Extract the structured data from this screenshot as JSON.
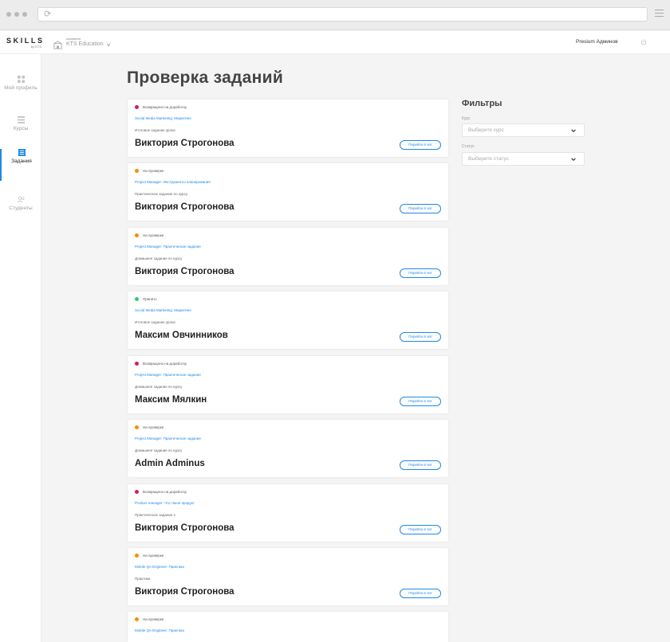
{
  "header": {
    "logo_main": "SKILLS",
    "logo_sub": "by KTS",
    "company_label": "компания",
    "company_name": "KTS Education",
    "user_name": "Presium Админов"
  },
  "sidebar": {
    "items": [
      {
        "label": "Мой профиль",
        "icon": "dashboard-icon",
        "active": false
      },
      {
        "label": "Курсы",
        "icon": "list-icon",
        "active": false
      },
      {
        "label": "Задания",
        "icon": "tasks-icon",
        "active": true
      },
      {
        "label": "Студенты",
        "icon": "users-icon",
        "active": false
      }
    ]
  },
  "page": {
    "title": "Проверка заданий",
    "chat_button_label": "Перейти в чат"
  },
  "colors": {
    "accent": "#1e88e5",
    "status_returned": "#d81b60",
    "status_review": "#fb8c00",
    "status_accepted": "#2ecc71"
  },
  "cards": [
    {
      "status": "Возвращено на доработку",
      "course": "Social Media Marketing: Маркетинг",
      "task": "Итоговое задание урока",
      "student": "Виктория Строгонова"
    },
    {
      "status": "На проверке",
      "course": "Project Manager: Инструменты планирования",
      "task": "Практическое задание по курсу",
      "student": "Виктория Строгонова"
    },
    {
      "status": "На проверке",
      "course": "Project Manager: Практическое задание",
      "task": "Домашнее задание по курсу",
      "student": "Виктория Строгонова"
    },
    {
      "status": "Принято",
      "course": "Social Media Marketing: Маркетинг",
      "task": "Итоговое задание урока",
      "student": "Максим Овчинников"
    },
    {
      "status": "Возвращено на доработку",
      "course": "Project Manager: Практическое задание",
      "task": "Домашнее задание по курсу",
      "student": "Максим Мялкин"
    },
    {
      "status": "На проверке",
      "course": "Project Manager: Практическое задание",
      "task": "Домашнее задание по курсу",
      "student": "Admin Adminus"
    },
    {
      "status": "Возвращено на доработку",
      "course": "Product manager: Что такое продукт",
      "task": "Практическое задание 1",
      "student": "Виктория Строгонова"
    },
    {
      "status": "На проверке",
      "course": "Mobile QA Engineer: Практика",
      "task": "Практика",
      "student": "Виктория Строгонова"
    },
    {
      "status": "На проверке",
      "course": "Mobile QA Engineer: Практика",
      "task": "",
      "student": ""
    }
  ],
  "filters": {
    "title": "Фильтры",
    "course_label": "Курс",
    "course_placeholder": "Выберите курс",
    "status_label": "Статус",
    "status_placeholder": "Выберите статус"
  }
}
